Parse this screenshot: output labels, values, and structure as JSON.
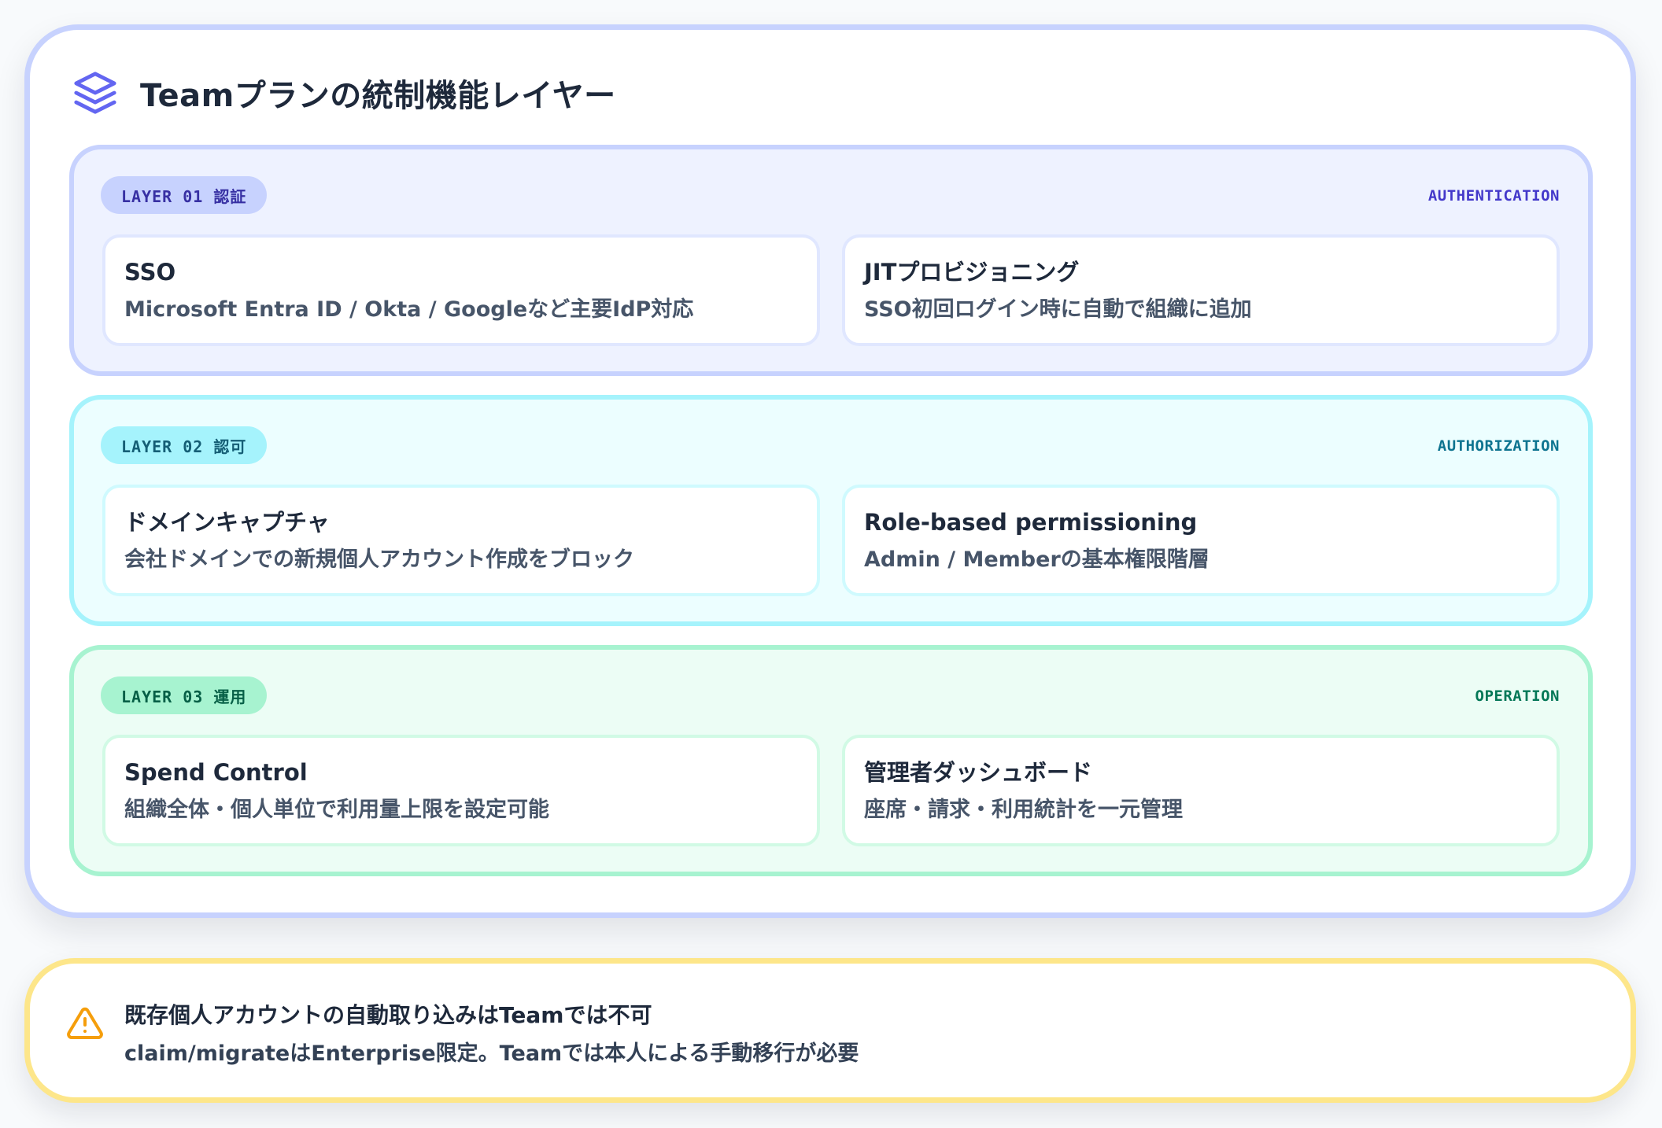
{
  "title": "Teamプランの統制機能レイヤー",
  "icons": {
    "title": "layers-icon",
    "warning": "warning-triangle-icon"
  },
  "colors": {
    "accent": "#6366f1",
    "layer1": "#c7d2fe",
    "layer2": "#a5f3fc",
    "layer3": "#a7f3d0",
    "warning": "#f59e0b"
  },
  "layers": [
    {
      "badge": "LAYER 01 認証",
      "tag": "AUTHENTICATION",
      "items": [
        {
          "title": "SSO",
          "desc": "Microsoft Entra ID / Okta / Googleなど主要IdP対応"
        },
        {
          "title": "JITプロビジョニング",
          "desc": "SSO初回ログイン時に自動で組織に追加"
        }
      ]
    },
    {
      "badge": "LAYER 02 認可",
      "tag": "AUTHORIZATION",
      "items": [
        {
          "title": "ドメインキャプチャ",
          "desc": "会社ドメインでの新規個人アカウント作成をブロック"
        },
        {
          "title": "Role-based permissioning",
          "desc": "Admin / Memberの基本権限階層"
        }
      ]
    },
    {
      "badge": "LAYER 03 運用",
      "tag": "OPERATION",
      "items": [
        {
          "title": "Spend Control",
          "desc": "組織全体・個人単位で利用量上限を設定可能"
        },
        {
          "title": "管理者ダッシュボード",
          "desc": "座席・請求・利用統計を一元管理"
        }
      ]
    }
  ],
  "warning": {
    "title": "既存個人アカウントの自動取り込みはTeamでは不可",
    "desc": "claim/migrateはEnterprise限定。Teamでは本人による手動移行が必要"
  }
}
